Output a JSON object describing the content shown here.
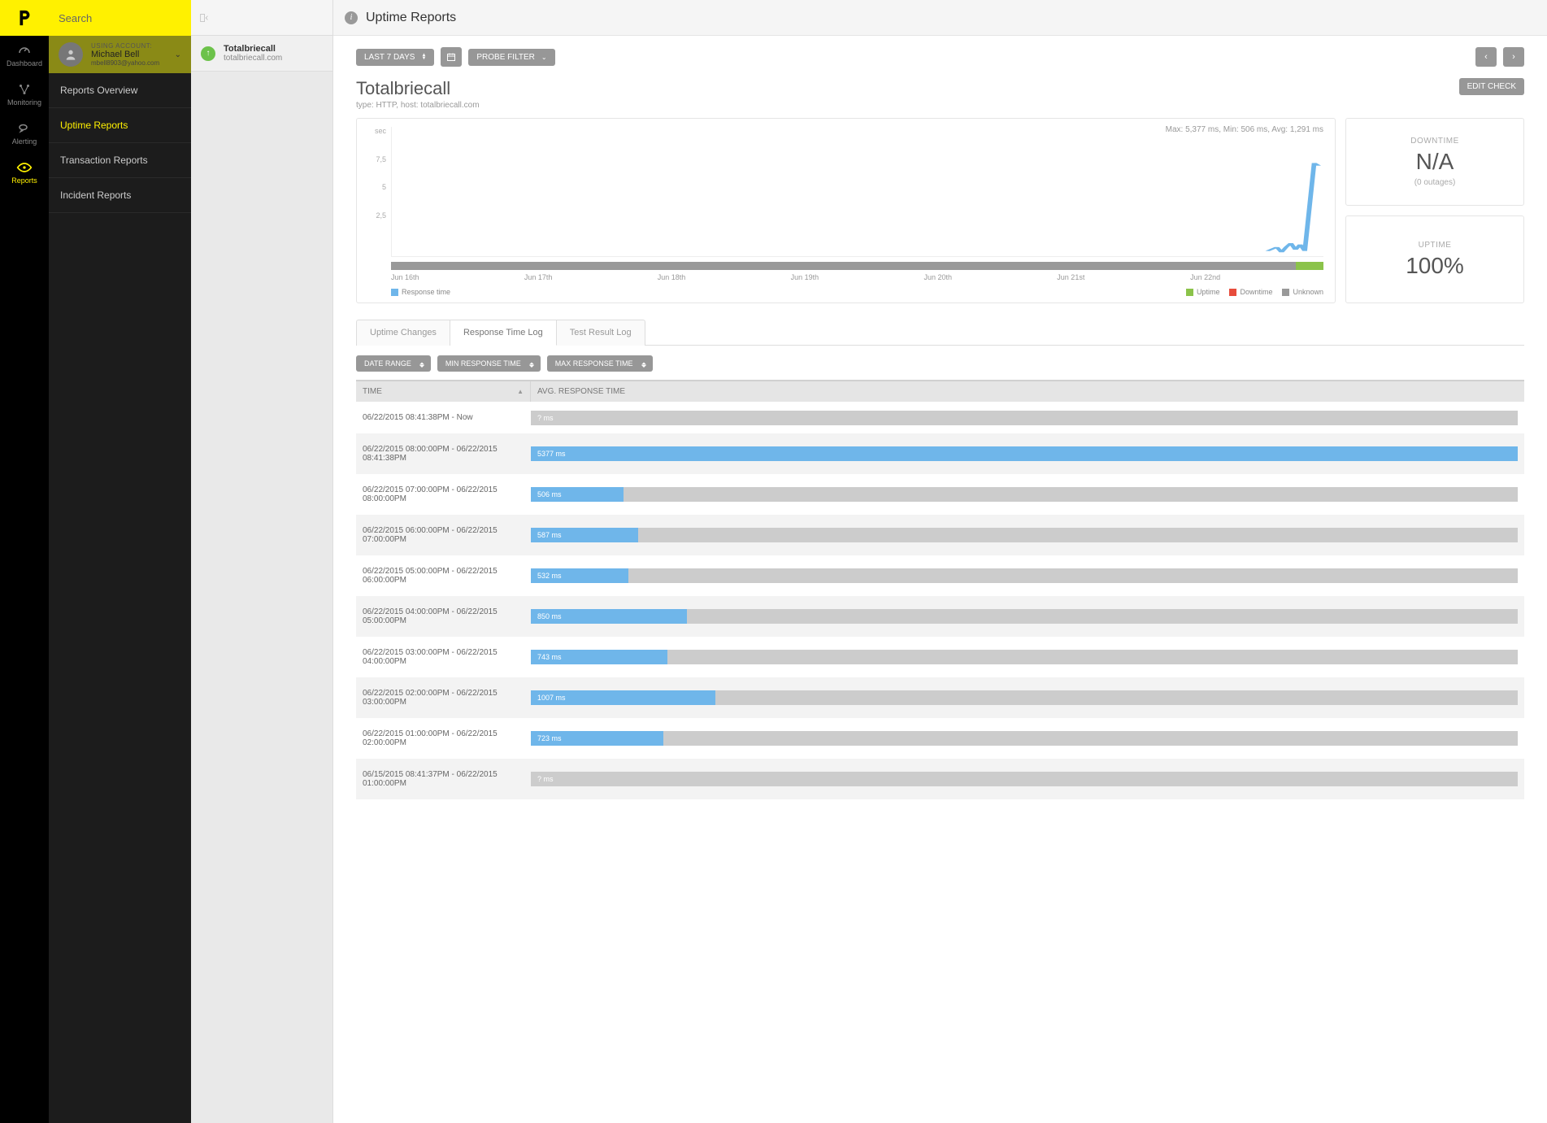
{
  "search": {
    "placeholder": "Search"
  },
  "account": {
    "label": "USING ACCOUNT:",
    "name": "Michael Bell",
    "email": "mbell8903@yahoo.com"
  },
  "rail": {
    "items": [
      {
        "label": "Dashboard"
      },
      {
        "label": "Monitoring"
      },
      {
        "label": "Alerting"
      },
      {
        "label": "Reports"
      }
    ]
  },
  "sidebar": {
    "items": [
      {
        "label": "Reports Overview"
      },
      {
        "label": "Uptime Reports"
      },
      {
        "label": "Transaction Reports"
      },
      {
        "label": "Incident Reports"
      }
    ]
  },
  "check_list": {
    "items": [
      {
        "name": "Totalbriecall",
        "host": "totalbriecall.com"
      }
    ]
  },
  "topbar": {
    "title": "Uptime Reports"
  },
  "filters": {
    "range": "LAST 7 DAYS",
    "probe": "PROBE FILTER"
  },
  "check": {
    "title": "Totalbriecall",
    "subtitle": "type: HTTP, host: totalbriecall.com",
    "edit": "EDIT CHECK"
  },
  "chart_data": {
    "type": "line",
    "title": "",
    "y_unit": "sec",
    "y_ticks": [
      "7,5",
      "5",
      "2,5"
    ],
    "ylim": [
      0,
      7.5
    ],
    "x_ticks": [
      "Jun 16th",
      "Jun 17th",
      "Jun 18th",
      "Jun 19th",
      "Jun 20th",
      "Jun 21st",
      "Jun 22nd"
    ],
    "stats": "Max: 5,377 ms, Min: 506 ms, Avg: 1,291 ms",
    "series": [
      {
        "name": "Response time",
        "color": "#6fb6ea",
        "data_note": "near-zero plateau with spike to ~5.4s at end of Jun 22nd range"
      }
    ],
    "legend": {
      "left": [
        {
          "label": "Response time",
          "color": "#6fb6ea"
        }
      ],
      "right": [
        {
          "label": "Uptime",
          "color": "#8bc34a"
        },
        {
          "label": "Downtime",
          "color": "#e74c3c"
        },
        {
          "label": "Unknown",
          "color": "#999999"
        }
      ]
    }
  },
  "stats": {
    "downtime": {
      "label": "DOWNTIME",
      "value": "N/A",
      "sub": "(0 outages)"
    },
    "uptime": {
      "label": "UPTIME",
      "value": "100%"
    }
  },
  "tabs": [
    {
      "label": "Uptime Changes"
    },
    {
      "label": "Response Time Log"
    },
    {
      "label": "Test Result Log"
    }
  ],
  "range_filters": {
    "date": "DATE RANGE",
    "min": "MIN RESPONSE TIME",
    "max": "MAX RESPONSE TIME"
  },
  "table": {
    "headers": {
      "time": "TIME",
      "resp": "AVG. RESPONSE TIME"
    },
    "max_ms": 5377,
    "rows": [
      {
        "time": "06/22/2015 08:41:38PM - Now",
        "label": "? ms",
        "pct": 0,
        "unknown": true
      },
      {
        "time": "06/22/2015 08:00:00PM - 06/22/2015 08:41:38PM",
        "label": "5377 ms",
        "pct": 100
      },
      {
        "time": "06/22/2015 07:00:00PM - 06/22/2015 08:00:00PM",
        "label": "506 ms",
        "pct": 9.4
      },
      {
        "time": "06/22/2015 06:00:00PM - 06/22/2015 07:00:00PM",
        "label": "587 ms",
        "pct": 10.9
      },
      {
        "time": "06/22/2015 05:00:00PM - 06/22/2015 06:00:00PM",
        "label": "532 ms",
        "pct": 9.9
      },
      {
        "time": "06/22/2015 04:00:00PM - 06/22/2015 05:00:00PM",
        "label": "850 ms",
        "pct": 15.8
      },
      {
        "time": "06/22/2015 03:00:00PM - 06/22/2015 04:00:00PM",
        "label": "743 ms",
        "pct": 13.8
      },
      {
        "time": "06/22/2015 02:00:00PM - 06/22/2015 03:00:00PM",
        "label": "1007 ms",
        "pct": 18.7
      },
      {
        "time": "06/22/2015 01:00:00PM - 06/22/2015 02:00:00PM",
        "label": "723 ms",
        "pct": 13.4
      },
      {
        "time": "06/15/2015 08:41:37PM - 06/22/2015 01:00:00PM",
        "label": "? ms",
        "pct": 0,
        "unknown": true
      }
    ]
  }
}
